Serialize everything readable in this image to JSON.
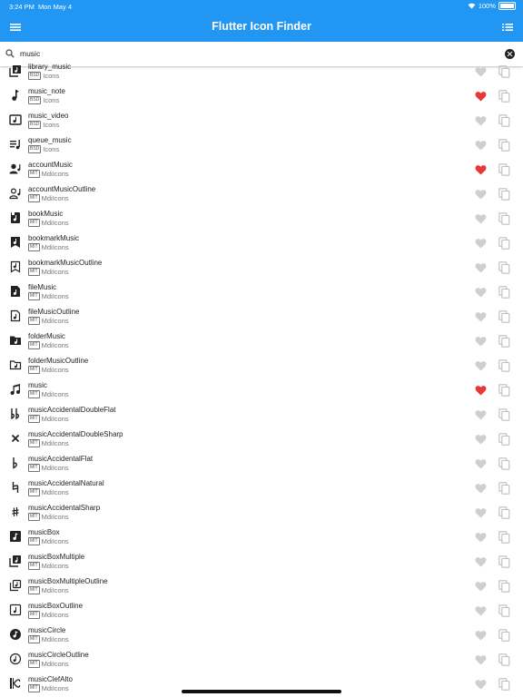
{
  "status_bar": {
    "time": "3:24 PM",
    "date": "Mon May 4",
    "battery": "100%"
  },
  "app_bar": {
    "title": "Flutter Icon Finder"
  },
  "search": {
    "value": "music",
    "placeholder": ""
  },
  "colors": {
    "primary": "#2196f3",
    "favorite_on": "#e53935",
    "favorite_off": "#cfcfcf",
    "copy": "#bdbdbd",
    "text": "#222222",
    "subtext": "#757575"
  },
  "icons": [
    {
      "name": "library_music",
      "license": "BSD",
      "pack": "Icons",
      "favorite": false,
      "glyph": "library-music-icon"
    },
    {
      "name": "music_note",
      "license": "BSD",
      "pack": "Icons",
      "favorite": true,
      "glyph": "music-note-icon"
    },
    {
      "name": "music_video",
      "license": "BSD",
      "pack": "Icons",
      "favorite": false,
      "glyph": "music-video-icon"
    },
    {
      "name": "queue_music",
      "license": "BSD",
      "pack": "Icons",
      "favorite": false,
      "glyph": "queue-music-icon"
    },
    {
      "name": "accountMusic",
      "license": "MIT",
      "pack": "MdiIcons",
      "favorite": true,
      "glyph": "account-music-icon"
    },
    {
      "name": "accountMusicOutline",
      "license": "MIT",
      "pack": "MdiIcons",
      "favorite": false,
      "glyph": "account-music-outline-icon"
    },
    {
      "name": "bookMusic",
      "license": "MIT",
      "pack": "MdiIcons",
      "favorite": false,
      "glyph": "book-music-icon"
    },
    {
      "name": "bookmarkMusic",
      "license": "MIT",
      "pack": "MdiIcons",
      "favorite": false,
      "glyph": "bookmark-music-icon"
    },
    {
      "name": "bookmarkMusicOutline",
      "license": "MIT",
      "pack": "MdiIcons",
      "favorite": false,
      "glyph": "bookmark-music-outline-icon"
    },
    {
      "name": "fileMusic",
      "license": "MIT",
      "pack": "MdiIcons",
      "favorite": false,
      "glyph": "file-music-icon"
    },
    {
      "name": "fileMusicOutline",
      "license": "MIT",
      "pack": "MdiIcons",
      "favorite": false,
      "glyph": "file-music-outline-icon"
    },
    {
      "name": "folderMusic",
      "license": "MIT",
      "pack": "MdiIcons",
      "favorite": false,
      "glyph": "folder-music-icon"
    },
    {
      "name": "folderMusicOutline",
      "license": "MIT",
      "pack": "MdiIcons",
      "favorite": false,
      "glyph": "folder-music-outline-icon"
    },
    {
      "name": "music",
      "license": "MIT",
      "pack": "MdiIcons",
      "favorite": true,
      "glyph": "music-icon"
    },
    {
      "name": "musicAccidentalDoubleFlat",
      "license": "MIT",
      "pack": "MdiIcons",
      "favorite": false,
      "glyph": "double-flat-icon"
    },
    {
      "name": "musicAccidentalDoubleSharp",
      "license": "MIT",
      "pack": "MdiIcons",
      "favorite": false,
      "glyph": "double-sharp-icon"
    },
    {
      "name": "musicAccidentalFlat",
      "license": "MIT",
      "pack": "MdiIcons",
      "favorite": false,
      "glyph": "flat-icon"
    },
    {
      "name": "musicAccidentalNatural",
      "license": "MIT",
      "pack": "MdiIcons",
      "favorite": false,
      "glyph": "natural-icon"
    },
    {
      "name": "musicAccidentalSharp",
      "license": "MIT",
      "pack": "MdiIcons",
      "favorite": false,
      "glyph": "sharp-icon"
    },
    {
      "name": "musicBox",
      "license": "MIT",
      "pack": "MdiIcons",
      "favorite": false,
      "glyph": "music-box-icon"
    },
    {
      "name": "musicBoxMultiple",
      "license": "MIT",
      "pack": "MdiIcons",
      "favorite": false,
      "glyph": "music-box-multiple-icon"
    },
    {
      "name": "musicBoxMultipleOutline",
      "license": "MIT",
      "pack": "MdiIcons",
      "favorite": false,
      "glyph": "music-box-multiple-outline-icon"
    },
    {
      "name": "musicBoxOutline",
      "license": "MIT",
      "pack": "MdiIcons",
      "favorite": false,
      "glyph": "music-box-outline-icon"
    },
    {
      "name": "musicCircle",
      "license": "MIT",
      "pack": "MdiIcons",
      "favorite": false,
      "glyph": "music-circle-icon"
    },
    {
      "name": "musicCircleOutline",
      "license": "MIT",
      "pack": "MdiIcons",
      "favorite": false,
      "glyph": "music-circle-outline-icon"
    },
    {
      "name": "musicClefAlto",
      "license": "MIT",
      "pack": "MdiIcons",
      "favorite": false,
      "glyph": "clef-alto-icon"
    }
  ]
}
